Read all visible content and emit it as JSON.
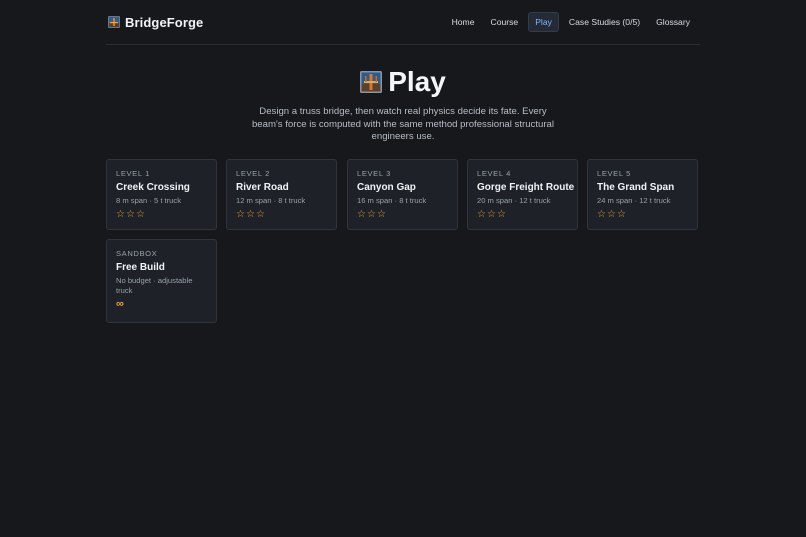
{
  "brand": {
    "name": "BridgeForge"
  },
  "nav": {
    "items": [
      {
        "label": "Home"
      },
      {
        "label": "Course"
      },
      {
        "label": "Play",
        "active": true
      },
      {
        "label": "Case Studies (0/5)"
      },
      {
        "label": "Glossary"
      }
    ]
  },
  "hero": {
    "title": "Play",
    "description": "Design a truss bridge, then watch real physics decide its fate. Every beam's force is computed with the same method professional structural engineers use."
  },
  "levels": [
    {
      "tag": "LEVEL 1",
      "title": "Creek Crossing",
      "meta": "8 m span · 5 t truck",
      "stars": 0,
      "max_stars": 3
    },
    {
      "tag": "LEVEL 2",
      "title": "River Road",
      "meta": "12 m span · 8 t truck",
      "stars": 0,
      "max_stars": 3
    },
    {
      "tag": "LEVEL 3",
      "title": "Canyon Gap",
      "meta": "16 m span · 8 t truck",
      "stars": 0,
      "max_stars": 3
    },
    {
      "tag": "LEVEL 4",
      "title": "Gorge Freight Route",
      "meta": "20 m span · 12 t truck",
      "stars": 0,
      "max_stars": 3
    },
    {
      "tag": "LEVEL 5",
      "title": "The Grand Span",
      "meta": "24 m span · 12 t truck",
      "stars": 0,
      "max_stars": 3
    }
  ],
  "sandbox": {
    "tag": "SANDBOX",
    "title": "Free Build",
    "meta": "No budget · adjustable truck",
    "symbol": "∞"
  },
  "colors": {
    "background": "#16181c",
    "card": "#1e2228",
    "accent": "#7fb5ff",
    "star": "#e8a33b"
  }
}
